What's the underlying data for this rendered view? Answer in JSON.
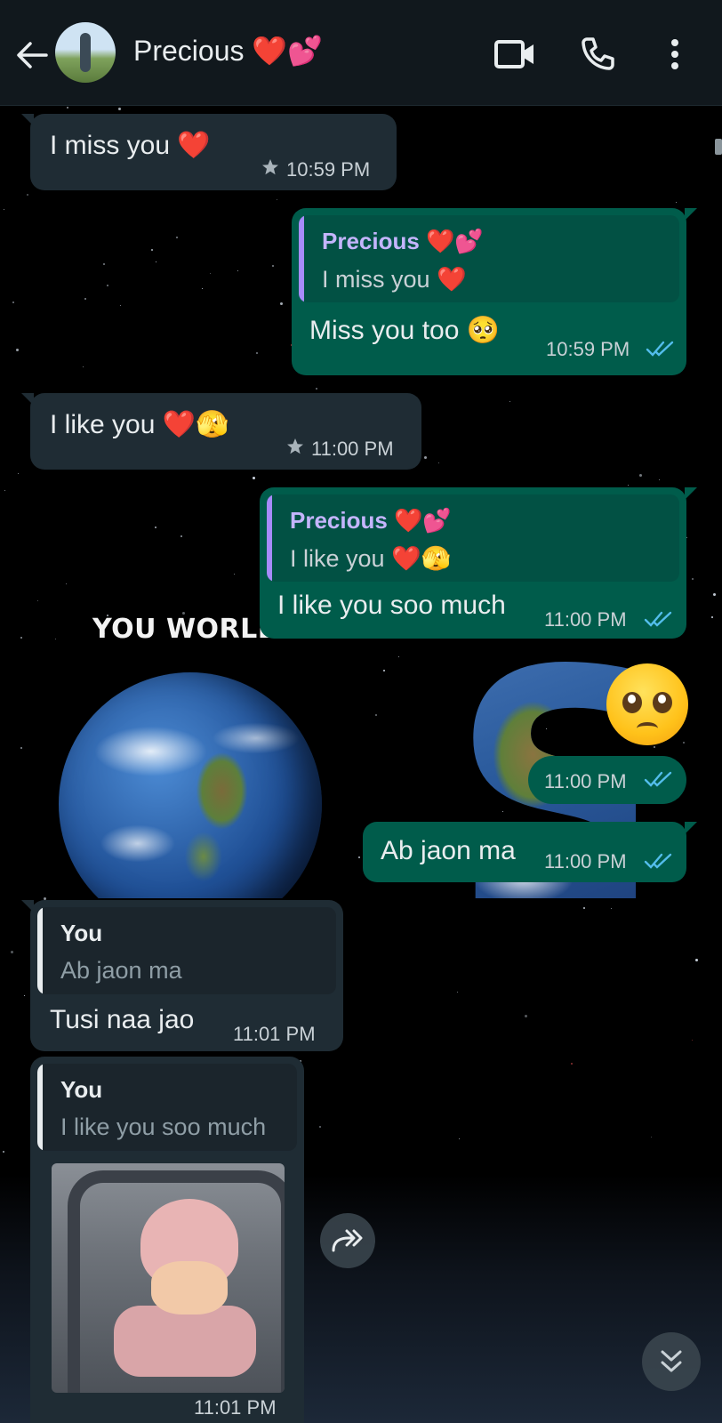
{
  "header": {
    "title": "Precious ❤️💕",
    "icons": [
      "back-arrow-icon",
      "video-call-icon",
      "voice-call-icon",
      "more-options-icon"
    ]
  },
  "background": {
    "wallpaper_text": "YOU WORLDS"
  },
  "messages": [
    {
      "dir": "in",
      "text": "I miss you ❤️",
      "time": "10:59 PM",
      "starred": true
    },
    {
      "dir": "out",
      "quote_author": "Precious ❤️💕",
      "quote_text": "I miss you ❤️",
      "text": "Miss you too 🥺",
      "time": "10:59 PM",
      "status": "read"
    },
    {
      "dir": "in",
      "text": "I like you ❤️🫣",
      "time": "11:00 PM",
      "starred": true
    },
    {
      "dir": "out",
      "quote_author": "Precious ❤️💕",
      "quote_text": "I like you ❤️🫣",
      "text": "I like you soo much",
      "time": "11:00 PM",
      "status": "read"
    },
    {
      "dir": "out",
      "text": "🥺",
      "time": "11:00 PM",
      "status": "read",
      "type": "sticker"
    },
    {
      "dir": "out",
      "text": "Ab jaon ma",
      "time": "11:00 PM",
      "status": "read"
    },
    {
      "dir": "in",
      "quote_author": "You",
      "quote_text": "Ab jaon ma",
      "text": "Tusi naa jao",
      "time": "11:01 PM"
    },
    {
      "dir": "in",
      "quote_author": "You",
      "quote_text": "I like you soo much",
      "type": "image",
      "time": "11:01 PM"
    }
  ],
  "colors": {
    "header_bg": "#11181d",
    "incoming_bubble": "#1f2c34",
    "outgoing_bubble": "#005c4b",
    "quote_bar_precious": "#a78bfa",
    "quote_author_you": "#e9edef",
    "read_ticks": "#53bdeb"
  }
}
